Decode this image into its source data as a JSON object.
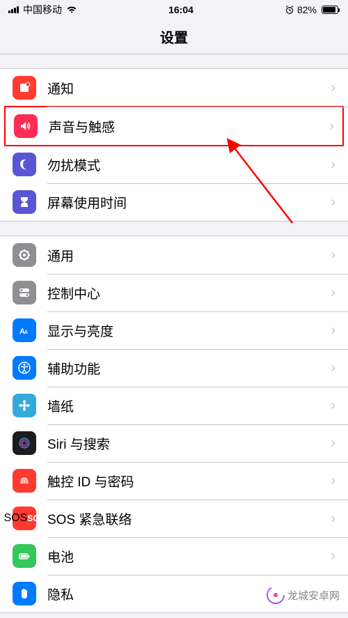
{
  "statusBar": {
    "carrier": "中国移动",
    "time": "16:04",
    "batteryPercent": "82%"
  },
  "header": {
    "title": "设置"
  },
  "sections": [
    {
      "rows": [
        {
          "icon": "notification",
          "bg": "#ff3b30",
          "label": "通知"
        },
        {
          "icon": "sound",
          "bg": "#ff2d55",
          "label": "声音与触感",
          "highlighted": true
        },
        {
          "icon": "dnd",
          "bg": "#5856d6",
          "label": "勿扰模式"
        },
        {
          "icon": "screentime",
          "bg": "#5856d6",
          "label": "屏幕使用时间"
        }
      ]
    },
    {
      "rows": [
        {
          "icon": "general",
          "bg": "#8e8e93",
          "label": "通用"
        },
        {
          "icon": "control",
          "bg": "#8e8e93",
          "label": "控制中心"
        },
        {
          "icon": "display",
          "bg": "#007aff",
          "label": "显示与亮度"
        },
        {
          "icon": "accessibility",
          "bg": "#007aff",
          "label": "辅助功能"
        },
        {
          "icon": "wallpaper",
          "bg": "#34aadc",
          "label": "墙纸"
        },
        {
          "icon": "siri",
          "bg": "#1c1c1e",
          "label": "Siri 与搜索"
        },
        {
          "icon": "touchid",
          "bg": "#ff3b30",
          "label": "触控 ID 与密码"
        },
        {
          "icon": "sos",
          "bg": "#ff3b30",
          "label": "SOS 紧急联络"
        },
        {
          "icon": "battery",
          "bg": "#34c759",
          "label": "电池"
        },
        {
          "icon": "privacy",
          "bg": "#007aff",
          "label": "隐私"
        }
      ]
    }
  ],
  "watermark": {
    "text": "龙城安卓网"
  }
}
